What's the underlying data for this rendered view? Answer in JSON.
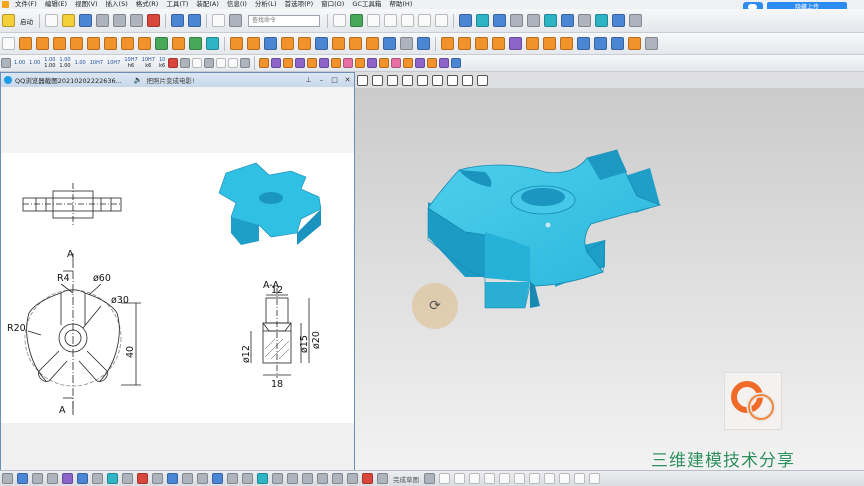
{
  "menubar": {
    "items": [
      "文件(F)",
      "编辑(E)",
      "视图(V)",
      "插入(S)",
      "格式(R)",
      "工具(T)",
      "装配(A)",
      "信息(I)",
      "分析(L)",
      "首选项(P)",
      "窗口(O)",
      "GC工具箱",
      "帮助(H)"
    ],
    "upload_label": "隐藏上传"
  },
  "toolbar": {
    "start_label": "启动",
    "search_placeholder": "查找命令",
    "tolerance_labels": [
      {
        "top": "1.00",
        "bottom": ""
      },
      {
        "top": "1.00",
        "bottom": "1.00"
      },
      {
        "top": "1.00",
        "bottom": "1.00"
      },
      {
        "top": "10H7",
        "bottom": ""
      },
      {
        "top": "10H7",
        "bottom": "h6"
      },
      {
        "top": "10H7",
        "bottom": "k6"
      },
      {
        "top": "10",
        "bottom": "k6"
      }
    ],
    "small_labels": [
      "1.00",
      "1.00",
      "10H7"
    ]
  },
  "float_window": {
    "title": "QQ浏览器截图20210202222636...",
    "subtitle": "把照片变成电影!"
  },
  "drawing": {
    "section_label": "A-A",
    "arrow_label_top": "A",
    "arrow_label_bottom": "A",
    "dims": {
      "r4": "R4",
      "d60": "ø60",
      "d30": "ø30",
      "r20": "R20",
      "h40": "40",
      "w12": "12",
      "d15": "ø15",
      "d20": "ø20",
      "d12": "ø12",
      "w18": "18"
    }
  },
  "watermark": "三维建模技术分享",
  "bottombar": {
    "sketch_label": "完成草图"
  },
  "colors": {
    "part_cyan": "#2fbfe0",
    "watermark_green": "#2d8f5c",
    "upload_blue": "#2c8cf0"
  }
}
